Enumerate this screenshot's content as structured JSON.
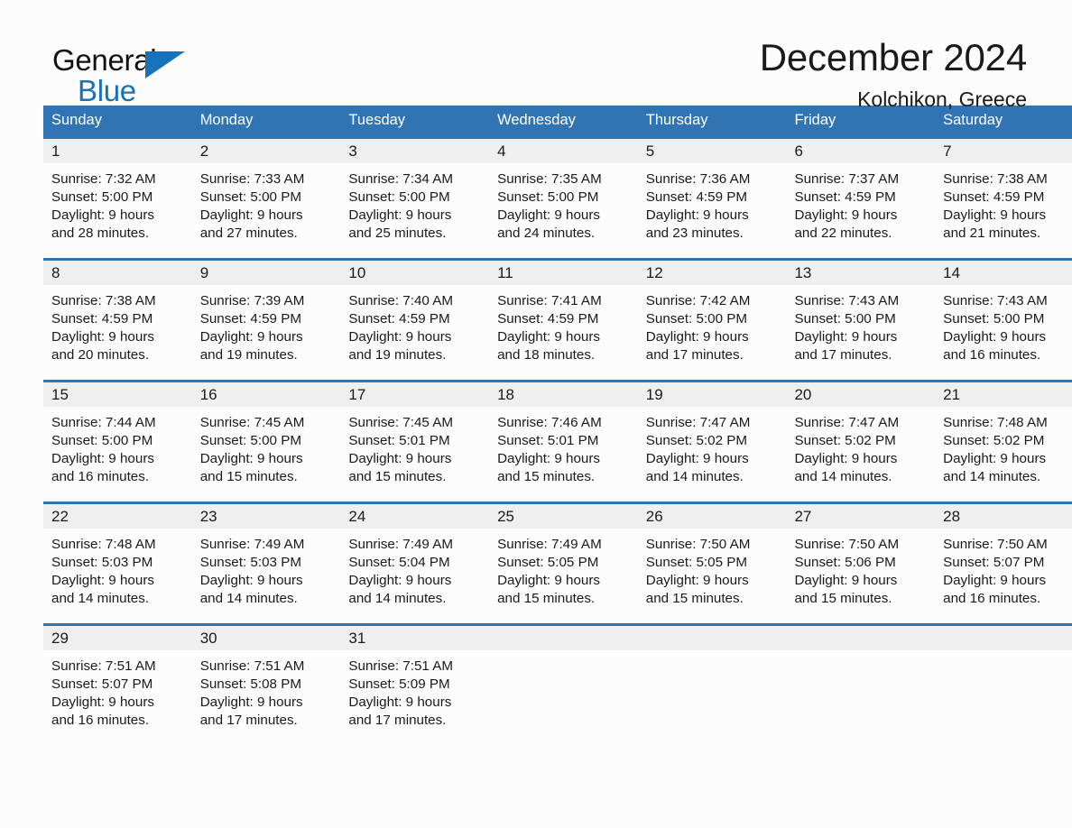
{
  "brand": {
    "name_part1": "General",
    "name_part2": "Blue",
    "accent_color": "#1672b9"
  },
  "header": {
    "title": "December 2024",
    "location": "Kolchikon, Greece"
  },
  "colors": {
    "header_blue": "#3174b4",
    "daynum_band": "#efefef",
    "page_background": "#fcfcfc",
    "text": "#1a1a1a"
  },
  "calendar": {
    "weekday_headers": [
      "Sunday",
      "Monday",
      "Tuesday",
      "Wednesday",
      "Thursday",
      "Friday",
      "Saturday"
    ],
    "weeks": [
      [
        {
          "day": "1",
          "info": "Sunrise: 7:32 AM\nSunset: 5:00 PM\nDaylight: 9 hours\nand 28 minutes."
        },
        {
          "day": "2",
          "info": "Sunrise: 7:33 AM\nSunset: 5:00 PM\nDaylight: 9 hours\nand 27 minutes."
        },
        {
          "day": "3",
          "info": "Sunrise: 7:34 AM\nSunset: 5:00 PM\nDaylight: 9 hours\nand 25 minutes."
        },
        {
          "day": "4",
          "info": "Sunrise: 7:35 AM\nSunset: 5:00 PM\nDaylight: 9 hours\nand 24 minutes."
        },
        {
          "day": "5",
          "info": "Sunrise: 7:36 AM\nSunset: 4:59 PM\nDaylight: 9 hours\nand 23 minutes."
        },
        {
          "day": "6",
          "info": "Sunrise: 7:37 AM\nSunset: 4:59 PM\nDaylight: 9 hours\nand 22 minutes."
        },
        {
          "day": "7",
          "info": "Sunrise: 7:38 AM\nSunset: 4:59 PM\nDaylight: 9 hours\nand 21 minutes."
        }
      ],
      [
        {
          "day": "8",
          "info": "Sunrise: 7:38 AM\nSunset: 4:59 PM\nDaylight: 9 hours\nand 20 minutes."
        },
        {
          "day": "9",
          "info": "Sunrise: 7:39 AM\nSunset: 4:59 PM\nDaylight: 9 hours\nand 19 minutes."
        },
        {
          "day": "10",
          "info": "Sunrise: 7:40 AM\nSunset: 4:59 PM\nDaylight: 9 hours\nand 19 minutes."
        },
        {
          "day": "11",
          "info": "Sunrise: 7:41 AM\nSunset: 4:59 PM\nDaylight: 9 hours\nand 18 minutes."
        },
        {
          "day": "12",
          "info": "Sunrise: 7:42 AM\nSunset: 5:00 PM\nDaylight: 9 hours\nand 17 minutes."
        },
        {
          "day": "13",
          "info": "Sunrise: 7:43 AM\nSunset: 5:00 PM\nDaylight: 9 hours\nand 17 minutes."
        },
        {
          "day": "14",
          "info": "Sunrise: 7:43 AM\nSunset: 5:00 PM\nDaylight: 9 hours\nand 16 minutes."
        }
      ],
      [
        {
          "day": "15",
          "info": "Sunrise: 7:44 AM\nSunset: 5:00 PM\nDaylight: 9 hours\nand 16 minutes."
        },
        {
          "day": "16",
          "info": "Sunrise: 7:45 AM\nSunset: 5:00 PM\nDaylight: 9 hours\nand 15 minutes."
        },
        {
          "day": "17",
          "info": "Sunrise: 7:45 AM\nSunset: 5:01 PM\nDaylight: 9 hours\nand 15 minutes."
        },
        {
          "day": "18",
          "info": "Sunrise: 7:46 AM\nSunset: 5:01 PM\nDaylight: 9 hours\nand 15 minutes."
        },
        {
          "day": "19",
          "info": "Sunrise: 7:47 AM\nSunset: 5:02 PM\nDaylight: 9 hours\nand 14 minutes."
        },
        {
          "day": "20",
          "info": "Sunrise: 7:47 AM\nSunset: 5:02 PM\nDaylight: 9 hours\nand 14 minutes."
        },
        {
          "day": "21",
          "info": "Sunrise: 7:48 AM\nSunset: 5:02 PM\nDaylight: 9 hours\nand 14 minutes."
        }
      ],
      [
        {
          "day": "22",
          "info": "Sunrise: 7:48 AM\nSunset: 5:03 PM\nDaylight: 9 hours\nand 14 minutes."
        },
        {
          "day": "23",
          "info": "Sunrise: 7:49 AM\nSunset: 5:03 PM\nDaylight: 9 hours\nand 14 minutes."
        },
        {
          "day": "24",
          "info": "Sunrise: 7:49 AM\nSunset: 5:04 PM\nDaylight: 9 hours\nand 14 minutes."
        },
        {
          "day": "25",
          "info": "Sunrise: 7:49 AM\nSunset: 5:05 PM\nDaylight: 9 hours\nand 15 minutes."
        },
        {
          "day": "26",
          "info": "Sunrise: 7:50 AM\nSunset: 5:05 PM\nDaylight: 9 hours\nand 15 minutes."
        },
        {
          "day": "27",
          "info": "Sunrise: 7:50 AM\nSunset: 5:06 PM\nDaylight: 9 hours\nand 15 minutes."
        },
        {
          "day": "28",
          "info": "Sunrise: 7:50 AM\nSunset: 5:07 PM\nDaylight: 9 hours\nand 16 minutes."
        }
      ],
      [
        {
          "day": "29",
          "info": "Sunrise: 7:51 AM\nSunset: 5:07 PM\nDaylight: 9 hours\nand 16 minutes."
        },
        {
          "day": "30",
          "info": "Sunrise: 7:51 AM\nSunset: 5:08 PM\nDaylight: 9 hours\nand 17 minutes."
        },
        {
          "day": "31",
          "info": "Sunrise: 7:51 AM\nSunset: 5:09 PM\nDaylight: 9 hours\nand 17 minutes."
        },
        {
          "day": "",
          "info": ""
        },
        {
          "day": "",
          "info": ""
        },
        {
          "day": "",
          "info": ""
        },
        {
          "day": "",
          "info": ""
        }
      ]
    ]
  }
}
